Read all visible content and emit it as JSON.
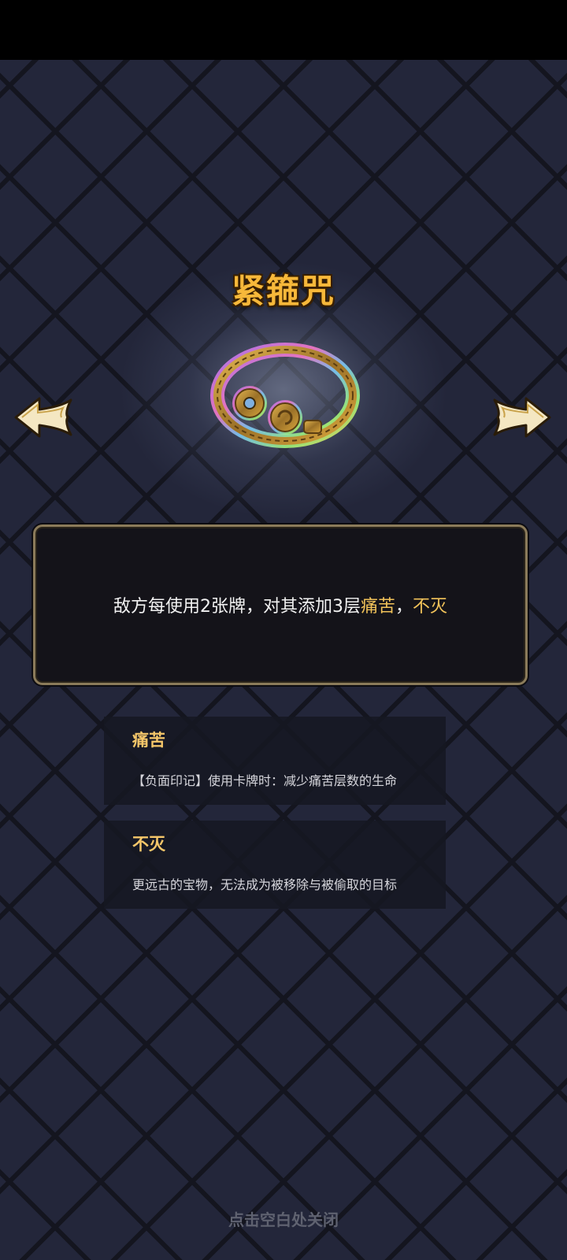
{
  "item": {
    "name": "紧箍咒",
    "icon": "golden-headband-icon"
  },
  "navigation": {
    "prev_icon": "arrow-left-icon",
    "next_icon": "arrow-right-icon"
  },
  "description": {
    "prefix": "敌方每使用2张牌，对其添加3层",
    "keyword1": "痛苦",
    "separator": "，",
    "keyword2": "不灭"
  },
  "keywords": [
    {
      "title": "痛苦",
      "text": "【负面印记】使用卡牌时：减少痛苦层数的生命"
    },
    {
      "title": "不灭",
      "text": "更远古的宝物，无法成为被移除与被偷取的目标"
    }
  ],
  "close_hint": "点击空白处关闭",
  "colors": {
    "title": "#f7b83a",
    "keyword": "#f2c35a",
    "box_border": "#8b7b5a"
  }
}
